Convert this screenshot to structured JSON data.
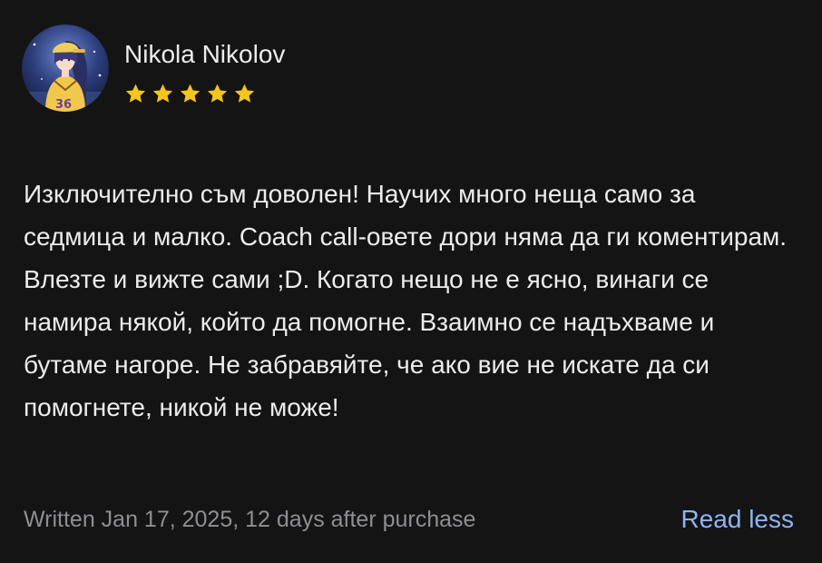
{
  "review": {
    "reviewer_name": "Nikola Nikolov",
    "avatar_icon": "user-avatar",
    "avatar_jersey_text": "36",
    "rating": 5,
    "rating_max": 5,
    "star_color": "#f5c518",
    "text": "Изключително съм доволен! Научих много неща само за седмица и малко. Coach call-овете дори няма да ги коментирам. Влезте и вижте сами ;D. Когато нещо не е ясно, винаги се намира някой, който да помогне. Взаимно се надъхваме и бутаме нагоре. Не забравяйте, че ако вие не искате да си помогнете, никой не може!",
    "meta": "Written Jan 17, 2025, 12 days after purchase",
    "read_less_label": "Read less",
    "link_color": "#8fb4f5"
  }
}
